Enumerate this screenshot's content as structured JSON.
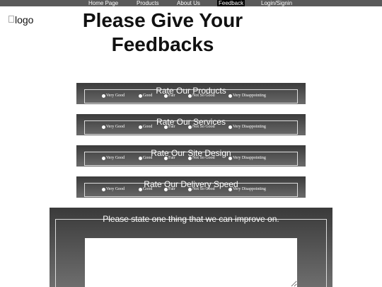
{
  "nav": {
    "items": [
      {
        "label": "Home Page"
      },
      {
        "label": "Products"
      },
      {
        "label": "About Us"
      },
      {
        "label": "Feedback"
      },
      {
        "label": "Login/Signin"
      }
    ],
    "active": "Feedback"
  },
  "logo": {
    "alt": "logo"
  },
  "page_title": "Please Give Your Feedbacks",
  "rating_options": [
    "Very Good",
    "Good",
    "Fair",
    "Not So Good",
    "Very Disappointing"
  ],
  "ratings": [
    {
      "title": "Rate Our Products"
    },
    {
      "title": "Rate Our Services"
    },
    {
      "title": "Rate Our Site Design"
    },
    {
      "title": "Rate Our Delivery Speed"
    }
  ],
  "improve": {
    "prompt": "Please state one thing that we can improve on.",
    "value": ""
  }
}
